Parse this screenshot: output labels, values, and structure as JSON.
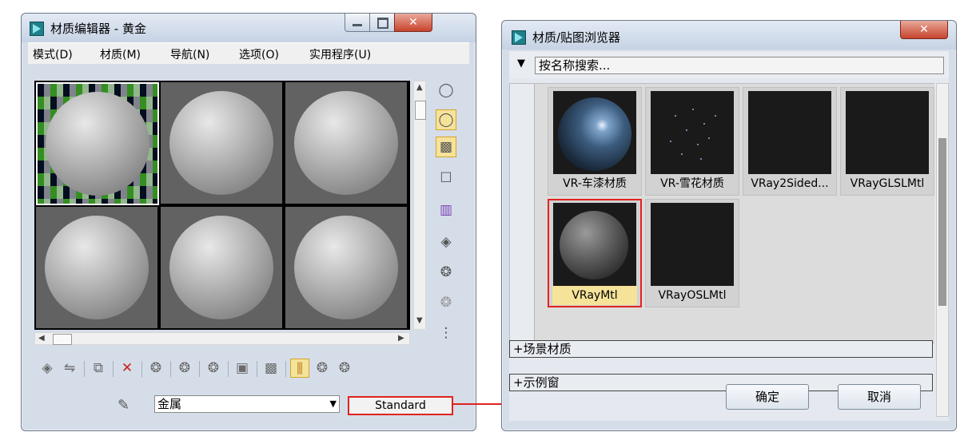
{
  "material_editor": {
    "title": "材质编辑器 - 黄金",
    "menu": [
      "模式(D)",
      "材质(M)",
      "导航(N)",
      "选项(O)",
      "实用程序(U)"
    ],
    "material_name": "金属",
    "material_type_button": "Standard"
  },
  "material_browser": {
    "title": "材质/贴图浏览器",
    "search_placeholder": "按名称搜索...",
    "tiles": [
      "VR-车漆材质",
      "VR-雪花材质",
      "VRay2Sided...",
      "VRayGLSLMtl",
      "VRayMtl",
      "VRayOSLMtl"
    ],
    "selected_tile": "VRayMtl",
    "rollouts": [
      "+场景材质",
      "+示例窗"
    ],
    "ok_button": "确定",
    "cancel_button": "取消"
  },
  "colors": {
    "highlight_red": "#e0231f",
    "active_yellow": "#f6e39a"
  }
}
